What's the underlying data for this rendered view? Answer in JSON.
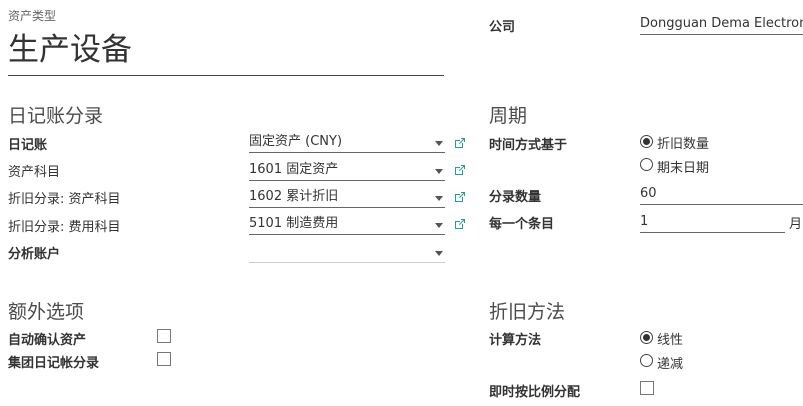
{
  "header": {
    "asset_type_label": "资产类型",
    "asset_type_value": "生产设备",
    "company_label": "公司",
    "company_value": "Dongguan Dema Electronic"
  },
  "journal_section": {
    "title": "日记账分录",
    "rows": [
      {
        "label": "日记账",
        "value": "固定资产 (CNY)"
      },
      {
        "label": "资产科目",
        "value": "1601 固定资产"
      },
      {
        "label": "折旧分录: 资产科目",
        "value": "1602 累计折旧"
      },
      {
        "label": "折旧分录: 费用科目",
        "value": "5101 制造费用"
      },
      {
        "label": "分析账户",
        "value": ""
      }
    ]
  },
  "period_section": {
    "title": "周期",
    "time_method_label": "时间方式基于",
    "options": [
      "折旧数量",
      "期末日期"
    ],
    "selected": "折旧数量",
    "entries_label": "分录数量",
    "entries_value": "60",
    "every_label": "每一个条目",
    "every_value": "1",
    "every_unit": "月"
  },
  "extra_section": {
    "title": "额外选项",
    "auto_confirm_label": "自动确认资产",
    "group_entries_label": "集团日记帐分录"
  },
  "depreciation_section": {
    "title": "折旧方法",
    "compute_label": "计算方法",
    "options": [
      "线性",
      "递减"
    ],
    "selected": "线性",
    "prorata_label": "即时按比例分配"
  },
  "colors": {
    "link_icon": "#21a08e",
    "text": "#4c4c4c"
  }
}
